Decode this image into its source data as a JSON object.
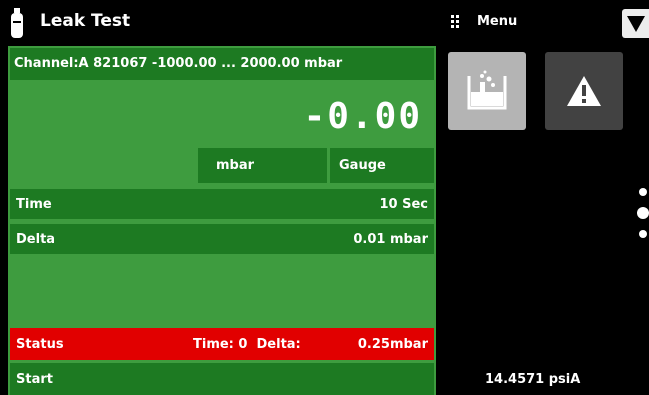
{
  "header": {
    "title": "Leak Test",
    "menu_label": "Menu"
  },
  "channel": {
    "label": "Channel:A 821067 -1000.00 ... 2000.00 mbar"
  },
  "reading": {
    "value": "-0.00",
    "unit": "mbar",
    "mode": "Gauge"
  },
  "settings": {
    "time_label": "Time",
    "time_value": "10 Sec",
    "delta_label": "Delta",
    "delta_value": "0.01 mbar"
  },
  "status": {
    "label": "Status",
    "detail": "Time: 0  Delta:",
    "delta_value": "0.25mbar"
  },
  "start": {
    "label": "Start"
  },
  "barometer": {
    "value": "14.4571 psiA"
  },
  "colors": {
    "panel": "#3e9c3f",
    "row": "#1d7a22",
    "status": "#e10000"
  }
}
